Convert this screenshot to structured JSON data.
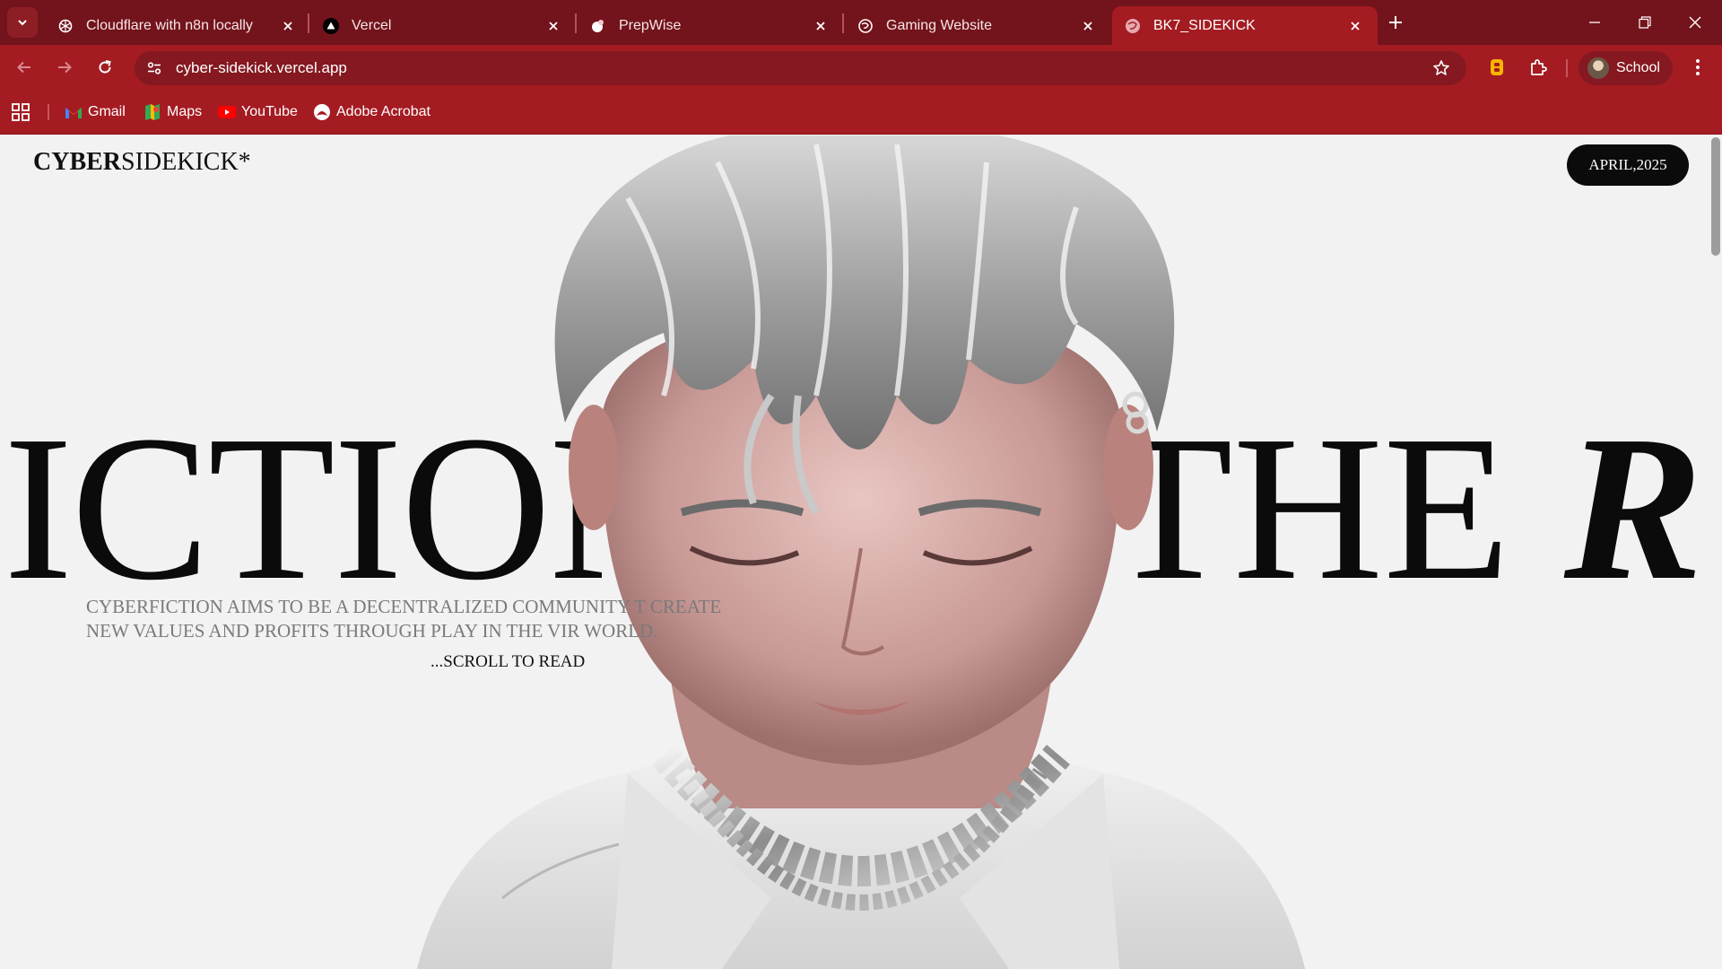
{
  "browser": {
    "tabs": [
      {
        "title": "Cloudflare with n8n locally",
        "icon": "openai-icon",
        "active": false
      },
      {
        "title": "Vercel",
        "icon": "vercel-icon",
        "active": false
      },
      {
        "title": "PrepWise",
        "icon": "prepwise-icon",
        "active": false
      },
      {
        "title": "Gaming Website",
        "icon": "globe-icon",
        "active": false
      },
      {
        "title": "BK7_SIDEKICK",
        "icon": "globe-icon",
        "active": true
      }
    ],
    "url": "cyber-sidekick.vercel.app",
    "profile_label": "School",
    "bookmarks": [
      {
        "label": "Gmail",
        "icon": "gmail-icon"
      },
      {
        "label": "Maps",
        "icon": "maps-icon"
      },
      {
        "label": "YouTube",
        "icon": "youtube-icon"
      },
      {
        "label": "Adobe Acrobat",
        "icon": "acrobat-icon"
      }
    ],
    "colors": {
      "tabbar": "#73131b",
      "toolbar": "#a41b22",
      "omnibox": "#851820"
    }
  },
  "page": {
    "logo_bold": "CYBER",
    "logo_regular": "SIDEKICK*",
    "date_badge": "APRIL,2025",
    "hero_left": "ICTION",
    "hero_right": "THE",
    "hero_right_italic": "R",
    "tagline": "CYBERFICTION AIMS TO BE A DECENTRALIZED COMMUNITY T CREATE NEW VALUES AND PROFITS THROUGH PLAY IN THE VIR WORLD.",
    "scroll_hint": "...SCROLL TO READ",
    "hero_image": "3d-character-silver-hair-portrait",
    "colors": {
      "background": "#f2f2f2",
      "text": "#0b0b0b",
      "tagline": "#7a7a7a"
    }
  }
}
